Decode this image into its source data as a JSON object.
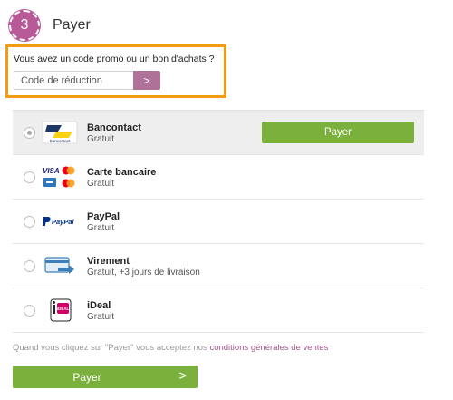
{
  "step": {
    "number": "3",
    "title": "Payer"
  },
  "promo": {
    "question": "Vous avez un code promo ou un bon d'achats ?",
    "placeholder": "Code de réduction",
    "submit_label": ">"
  },
  "methods": [
    {
      "name": "Bancontact",
      "detail": "Gratuit",
      "selected": true,
      "pay_label": "Payer",
      "logo_text": "Bancontact"
    },
    {
      "name": "Carte bancaire",
      "detail": "Gratuit",
      "selected": false,
      "logo_text": "VISA"
    },
    {
      "name": "PayPal",
      "detail": "Gratuit",
      "selected": false,
      "logo_text": "PayPal"
    },
    {
      "name": "Virement",
      "detail": "Gratuit, +3 jours de livraison",
      "selected": false
    },
    {
      "name": "iDeal",
      "detail": "Gratuit",
      "selected": false,
      "logo_text": "iDEAL"
    }
  ],
  "terms": {
    "prefix": "Quand vous cliquez sur \"Payer\" vous acceptez nos",
    "link": "conditions générales de ventes"
  },
  "pay_button": {
    "label": "Payer",
    "arrow": ">"
  },
  "colors": {
    "accent": "#b85a97",
    "highlight": "#f39c12",
    "pay_green": "#7ab03b"
  }
}
